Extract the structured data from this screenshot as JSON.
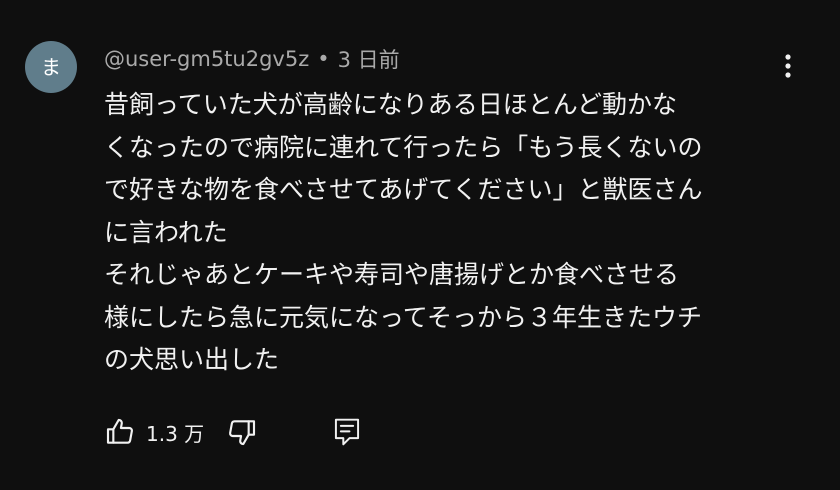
{
  "comment": {
    "avatar_initial": "ま",
    "author": "@user-gm5tu2gv5z",
    "separator": "•",
    "timestamp": "3 日前",
    "lines": [
      "昔飼っていた犬が高齢になりある日ほとんど動かな",
      "くなったので病院に連れて行ったら「もう長くないの",
      "で好きな物を食べさせてあげてください」と獣医さん",
      "に言われた",
      "それじゃあとケーキや寿司や唐揚げとか食べさせる",
      "様にしたら急に元気になってそっから３年生きたウチ",
      "の犬思い出した"
    ],
    "like_count": "1.3 万"
  },
  "icons": {
    "menu": "more-vert-icon",
    "like": "thumb-up-icon",
    "dislike": "thumb-down-icon",
    "reply": "comment-icon"
  },
  "colors": {
    "background": "#0f0f0f",
    "text_primary": "#f1f1f1",
    "text_secondary": "#aaaaaa",
    "avatar_bg": "#607d8b"
  }
}
